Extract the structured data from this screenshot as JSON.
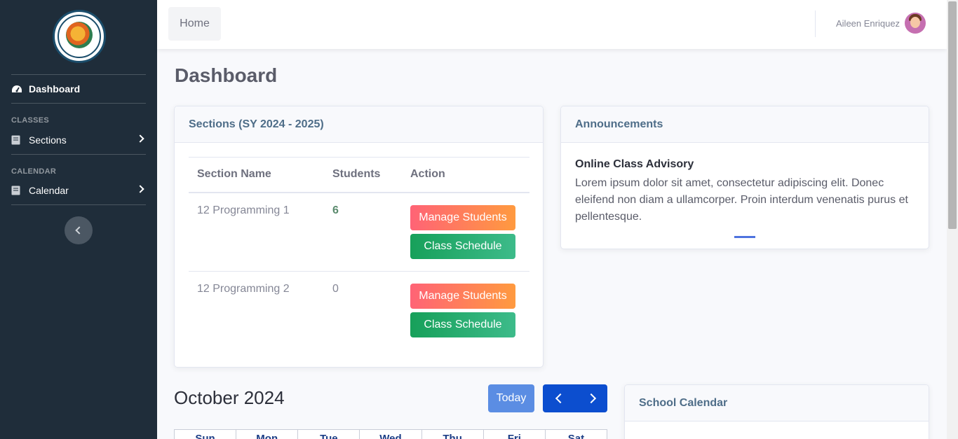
{
  "sidebar": {
    "nav_dashboard": "Dashboard",
    "heading_classes": "CLASSES",
    "nav_sections": "Sections",
    "heading_calendar": "CALENDAR",
    "nav_calendar": "Calendar",
    "icons": {
      "dashboard": "tachometer-icon",
      "sections": "book-icon",
      "calendar": "book-icon",
      "toggle": "chevron-left-icon"
    }
  },
  "topbar": {
    "home_tab": "Home",
    "user_name": "Aileen Enriquez"
  },
  "page": {
    "title": "Dashboard"
  },
  "sections_card": {
    "title": "Sections (SY 2024 - 2025)",
    "columns": [
      "Section Name",
      "Students",
      "Action"
    ],
    "rows": [
      {
        "name": "12 Programming 1",
        "students": "6",
        "manage": "Manage Students",
        "schedule": "Class Schedule"
      },
      {
        "name": "12 Programming 2",
        "students": "0",
        "manage": "Manage Students",
        "schedule": "Class Schedule"
      }
    ]
  },
  "announcements": {
    "title": "Announcements",
    "item_title": "Online Class Advisory",
    "item_body": "Lorem ipsum dolor sit amet, consectetur adipiscing elit. Donec eleifend non diam a ullamcorper. Proin interdum venenatis purus et pellentesque."
  },
  "calendar": {
    "month": "October 2024",
    "today_label": "Today",
    "days": [
      "Sun",
      "Mon",
      "Tue",
      "Wed",
      "Thu",
      "Fri",
      "Sat"
    ]
  },
  "school_calendar": {
    "title": "School Calendar"
  },
  "colors": {
    "sidebar": "#1f2d3a",
    "accent": "#4e73df",
    "manage_button": "#ff7a5c",
    "schedule_button": "#17a05a",
    "nav_button": "#0c4ecf"
  }
}
